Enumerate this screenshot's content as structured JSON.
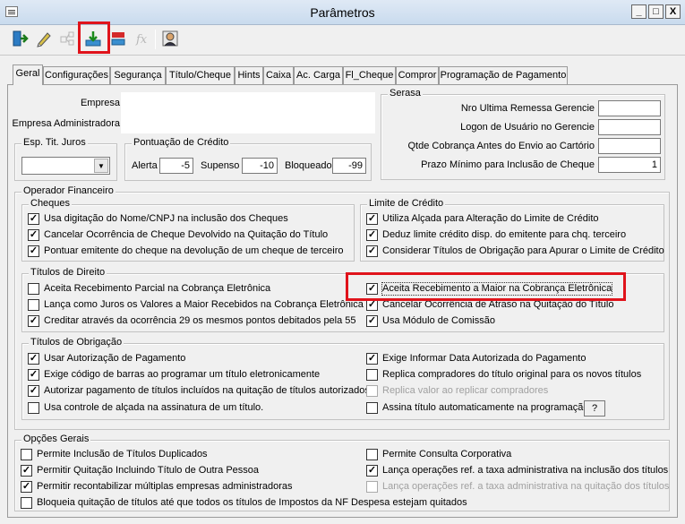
{
  "window": {
    "title": "Parâmetros",
    "minimize": "_",
    "maximize": "□",
    "close": "X"
  },
  "toolbar": {
    "icons": [
      "exit-icon",
      "edit-icon",
      "tree-icon",
      "save-icon",
      "cancel-icon",
      "formula-icon",
      "user-icon"
    ]
  },
  "tabs": [
    "Geral",
    "Configurações",
    "Segurança",
    "Título/Cheque",
    "Hints",
    "Caixa",
    "Ac. Carga",
    "Fl_Cheque",
    "Compror",
    "Programação de Pagamento"
  ],
  "geral": {
    "empresa_label": "Empresa",
    "empresa_adm_label": "Empresa  Administradora",
    "esp_tit_juros": {
      "title": "Esp. Tit. Juros",
      "value": ""
    },
    "pontuacao": {
      "title": "Pontuação de Crédito",
      "alerta_label": "Alerta",
      "alerta_value": "-5",
      "supenso_label": "Supenso",
      "supenso_value": "-10",
      "bloqueado_label": "Bloqueado",
      "bloqueado_value": "-99"
    },
    "serasa": {
      "title": "Serasa",
      "fields": [
        {
          "label": "Nro Ultima Remessa Gerencie",
          "value": ""
        },
        {
          "label": "Logon de Usuário no Gerencie",
          "value": ""
        },
        {
          "label": "Qtde Cobrança  Antes do Envio ao Cartório",
          "value": ""
        },
        {
          "label": "Prazo Mínimo para Inclusão de Cheque",
          "value": "1"
        }
      ]
    },
    "operador": {
      "title": "Operador Financeiro",
      "cheques": {
        "title": "Cheques",
        "items": [
          {
            "label": "Usa digitação do Nome/CNPJ na inclusão dos Cheques",
            "checked": "✓"
          },
          {
            "label": "Cancelar Ocorrência de Cheque Devolvido na Quitação do Título",
            "checked": "✓"
          },
          {
            "label": "Pontuar emitente do cheque na devolução de um cheque de terceiro",
            "checked": "✓"
          }
        ]
      },
      "limite": {
        "title": "Limite de Crédito",
        "items": [
          {
            "label": "Utiliza Alçada para Alteração do Limite de Crédito",
            "checked": "✓"
          },
          {
            "label": "Deduz limite crédito disp. do emitente para chq. terceiro",
            "checked": "✓"
          },
          {
            "label": "Considerar Títulos de Obrigação para Apurar o Limite de Crédito",
            "checked": "✓"
          }
        ]
      },
      "direito": {
        "title": "Títulos de Direito",
        "left": [
          {
            "label": "Aceita Recebimento Parcial na Cobrança Eletrônica",
            "checked": ""
          },
          {
            "label": "Lança como Juros os Valores a Maior Recebidos na Cobrança Eletrônica",
            "checked": ""
          },
          {
            "label": "Creditar através da ocorrência 29 os mesmos pontos debitados pela 55",
            "checked": "✓"
          }
        ],
        "right": [
          {
            "label": "Aceita Recebimento a Maior na Cobrança Eletrônica",
            "checked": "✓"
          },
          {
            "label": "Cancelar Ocorrência de Atraso na Quitação do Título",
            "checked": "✓"
          },
          {
            "label": "Usa Módulo de Comissão",
            "checked": "✓"
          }
        ]
      },
      "obrigacao": {
        "title": "Títulos de Obrigação",
        "left": [
          {
            "label": "Usar Autorização de Pagamento",
            "checked": "✓"
          },
          {
            "label": "Exige código de barras ao programar um título eletronicamente",
            "checked": "✓"
          },
          {
            "label": "Autorizar pagamento de títulos incluídos na quitação de títulos autorizados",
            "checked": "✓"
          },
          {
            "label": "Usa controle de alçada na assinatura de um título.",
            "checked": ""
          }
        ],
        "right": [
          {
            "label": "Exige Informar Data Autorizada do Pagamento",
            "checked": "✓"
          },
          {
            "label": "Replica compradores do título original para os novos títulos",
            "checked": ""
          },
          {
            "label": "Replica valor ao replicar compradores",
            "checked": ""
          },
          {
            "label": "Assina título automaticamente na programação.",
            "checked": ""
          }
        ],
        "help_button": "?"
      }
    },
    "opcoes": {
      "title": "Opções Gerais",
      "left": [
        {
          "label": "Permite Inclusão de Títulos Duplicados",
          "checked": ""
        },
        {
          "label": "Permitir Quitação Incluindo Título de Outra Pessoa",
          "checked": "✓"
        },
        {
          "label": "Permitir recontabilizar múltiplas empresas administradoras",
          "checked": "✓"
        },
        {
          "label": "Bloqueia quitação de títulos até que todos os títulos de Impostos da NF Despesa estejam quitados",
          "checked": ""
        }
      ],
      "right": [
        {
          "label": "Permite Consulta Corporativa",
          "checked": ""
        },
        {
          "label": "Lança operações ref. a taxa administrativa na inclusão dos títulos",
          "checked": "✓"
        },
        {
          "label": "Lança operações ref. a taxa administrativa na quitação dos títulos",
          "checked": ""
        }
      ]
    }
  }
}
